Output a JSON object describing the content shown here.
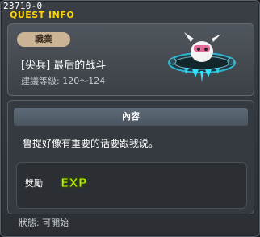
{
  "window": {
    "quest_id": "23710-0",
    "title": "QUEST INFO"
  },
  "quest": {
    "job_label": "職業",
    "name": "[尖兵] 最后的战斗",
    "level_text": "建議等級: 120～124"
  },
  "content": {
    "header": "內容",
    "text": "鲁提好像有重要的话要跟我说。"
  },
  "reward": {
    "label": "獎勵",
    "exp_badge": "EXP"
  },
  "status": {
    "text": "狀態: 可開始"
  },
  "colors": {
    "title": "#ffd400",
    "exp_fill": "#b7f000",
    "ufo_glow": "#33e0ff"
  }
}
